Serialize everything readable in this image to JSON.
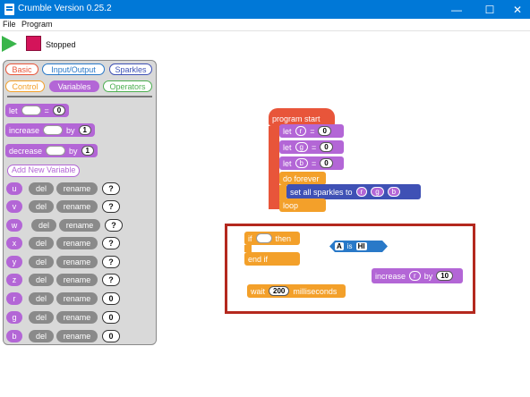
{
  "window": {
    "title": "Crumble Version 0.25.2",
    "minimize": "—",
    "maximize": "☐",
    "close": "✕"
  },
  "menu": {
    "file": "File",
    "program": "Program"
  },
  "toolbar": {
    "status": "Stopped"
  },
  "palette": {
    "tabs": [
      "Basic",
      "Input/Output",
      "Sparkles",
      "Control",
      "Variables",
      "Operators"
    ],
    "blocks": {
      "let_label": "let",
      "let_eq": "=",
      "let_value": "0",
      "increase_label": "increase",
      "increase_by": "by",
      "increase_value": "1",
      "decrease_label": "decrease",
      "decrease_by": "by",
      "decrease_value": "1"
    },
    "add_variable": "Add New Variable",
    "variables": [
      {
        "name": "u",
        "del": "del",
        "rename": "rename",
        "value": "?"
      },
      {
        "name": "v",
        "del": "del",
        "rename": "rename",
        "value": "?"
      },
      {
        "name": "w",
        "del": "del",
        "rename": "rename",
        "value": "?"
      },
      {
        "name": "x",
        "del": "del",
        "rename": "rename",
        "value": "?"
      },
      {
        "name": "y",
        "del": "del",
        "rename": "rename",
        "value": "?"
      },
      {
        "name": "z",
        "del": "del",
        "rename": "rename",
        "value": "?"
      },
      {
        "name": "r",
        "del": "del",
        "rename": "rename",
        "value": "0"
      },
      {
        "name": "g",
        "del": "del",
        "rename": "rename",
        "value": "0"
      },
      {
        "name": "b",
        "del": "del",
        "rename": "rename",
        "value": "0"
      }
    ]
  },
  "workspace": {
    "program_start": "program start",
    "lets": [
      {
        "label": "let",
        "var": "r",
        "eq": "=",
        "value": "0"
      },
      {
        "label": "let",
        "var": "g",
        "eq": "=",
        "value": "0"
      },
      {
        "label": "let",
        "var": "b",
        "eq": "=",
        "value": "0"
      }
    ],
    "do_forever": "do forever",
    "set_sparkles": {
      "label": "set all sparkles to",
      "r": "r",
      "g": "g",
      "b": "b"
    },
    "loop": "loop",
    "if_then": {
      "if": "if",
      "then": "then",
      "end_if": "end if"
    },
    "compare": {
      "left": "A",
      "op": "is",
      "right": "HI"
    },
    "increase": {
      "label": "increase",
      "var": "r",
      "by": "by",
      "value": "10"
    },
    "wait": {
      "label": "wait",
      "value": "200",
      "unit": "milliseconds"
    }
  }
}
